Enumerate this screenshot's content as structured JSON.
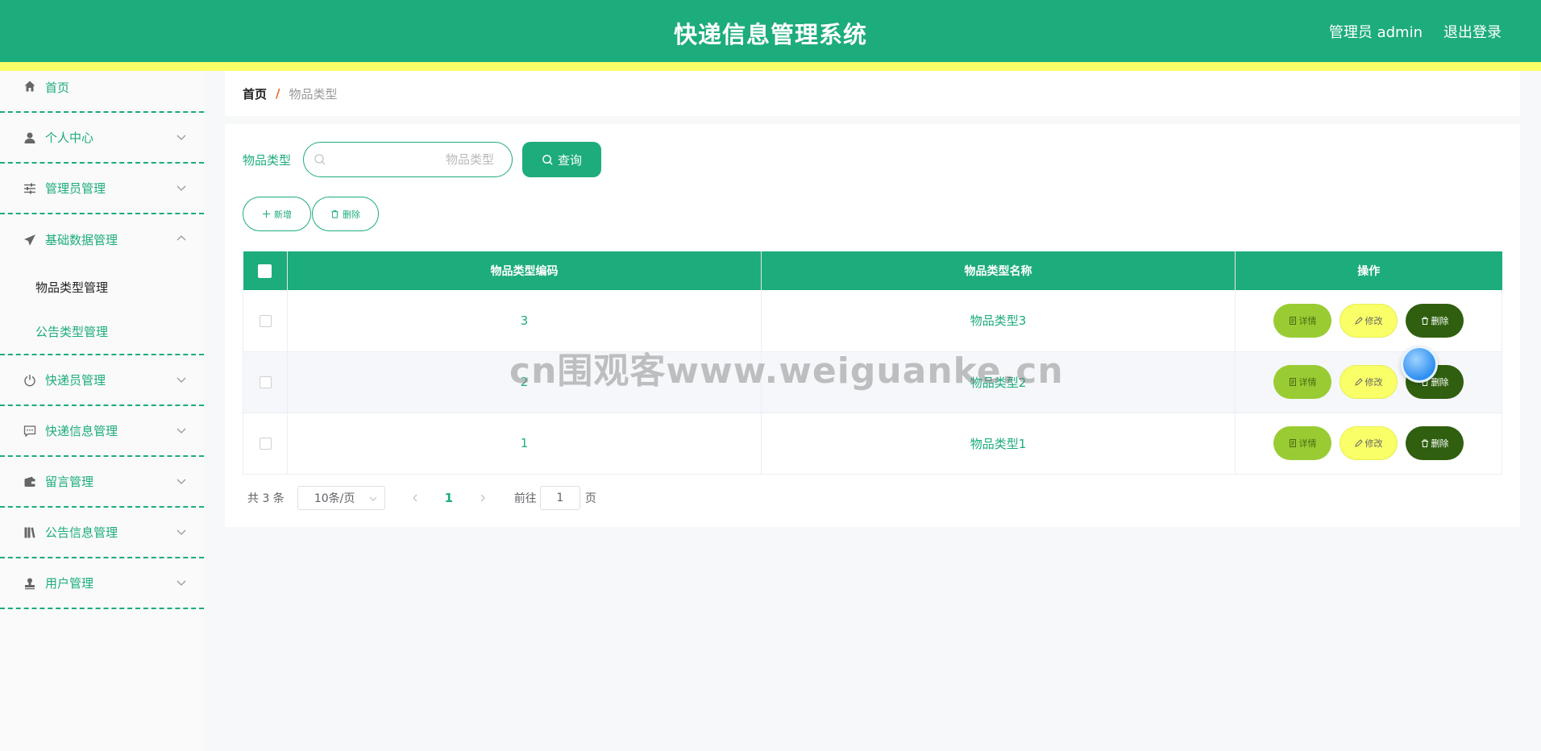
{
  "header": {
    "title": "快递信息管理系统",
    "user": "管理员 admin",
    "logout": "退出登录"
  },
  "sidebar": {
    "items": [
      {
        "label": "首页",
        "icon": "home-icon"
      },
      {
        "label": "个人中心",
        "icon": "user-icon"
      },
      {
        "label": "管理员管理",
        "icon": "sliders-icon"
      },
      {
        "label": "基础数据管理",
        "icon": "paper-plane-icon",
        "expanded": true,
        "children": [
          {
            "label": "物品类型管理",
            "active": true
          },
          {
            "label": "公告类型管理"
          }
        ]
      },
      {
        "label": "快递员管理",
        "icon": "power-icon"
      },
      {
        "label": "快递信息管理",
        "icon": "chat-icon"
      },
      {
        "label": "留言管理",
        "icon": "wallet-icon"
      },
      {
        "label": "公告信息管理",
        "icon": "book-icon"
      },
      {
        "label": "用户管理",
        "icon": "stamp-icon"
      }
    ]
  },
  "breadcrumb": {
    "home": "首页",
    "separator": "/",
    "current": "物品类型"
  },
  "search": {
    "label": "物品类型",
    "value": "",
    "placeholder": "物品类型",
    "button": "查询"
  },
  "actions": {
    "add": "新增",
    "delete": "删除"
  },
  "table": {
    "columns": [
      "物品类型编码",
      "物品类型名称",
      "操作"
    ],
    "rows": [
      {
        "code": "3",
        "name": "物品类型3"
      },
      {
        "code": "2",
        "name": "物品类型2"
      },
      {
        "code": "1",
        "name": "物品类型1"
      }
    ],
    "row_actions": {
      "detail": "详情",
      "edit": "修改",
      "remove": "删除"
    }
  },
  "pagination": {
    "total": "共 3 条",
    "page_size": "10条/页",
    "current_page": "1",
    "goto_label": "前往",
    "goto_value": "1",
    "page_unit": "页"
  },
  "watermark": "cn围观客www.weiguanke.cn",
  "colors": {
    "primary": "#1dac7b",
    "stripe": "#f9ff66",
    "detail": "#99cc33",
    "edit": "#f9ff66",
    "remove": "#2f5f0f",
    "breadcrumb_separator": "#e46a2a"
  }
}
